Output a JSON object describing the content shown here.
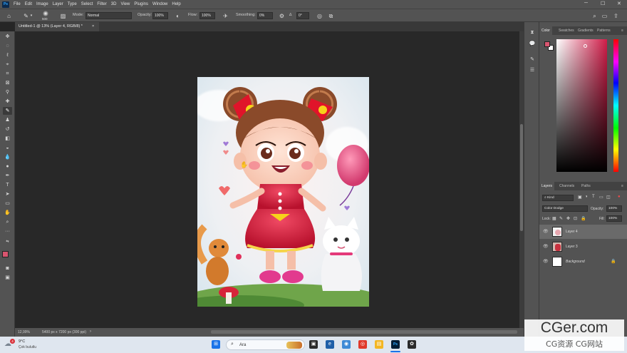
{
  "menubar": {
    "logo": "Ps",
    "items": [
      "File",
      "Edit",
      "Image",
      "Layer",
      "Type",
      "Select",
      "Filter",
      "3D",
      "View",
      "Plugins",
      "Window",
      "Help"
    ]
  },
  "options": {
    "brush_size": "500",
    "mode_label": "Mode:",
    "mode_value": "Normal",
    "opacity_label": "Opacity:",
    "opacity_value": "100%",
    "flow_label": "Flow:",
    "flow_value": "100%",
    "smoothing_label": "Smoothing:",
    "smoothing_value": "0%",
    "angle_label": "∆",
    "angle_value": "0°"
  },
  "document": {
    "tab_title": "Untitled-1 @ 13% (Layer 4, RGB/8) *",
    "tab_close": "×"
  },
  "status": {
    "zoom": "12,99%",
    "size": "5400 px x 7200 px (300 ppi)"
  },
  "color_panel": {
    "tabs": [
      "Color",
      "Swatches",
      "Gradients",
      "Patterns"
    ],
    "foreground": "#d9556f",
    "background": "#ffffff"
  },
  "layers_panel": {
    "tabs": [
      "Layers",
      "Channels",
      "Paths"
    ],
    "kind_label": "Kind",
    "blend_mode": "Color Dodge",
    "opacity_label": "Opacity:",
    "opacity_value": "100%",
    "lock_label": "Lock:",
    "fill_label": "Fill:",
    "fill_value": "100%",
    "layers": [
      {
        "name": "Layer 4",
        "selected": true
      },
      {
        "name": "Layer 3",
        "selected": false
      },
      {
        "name": "Background",
        "selected": false
      }
    ]
  },
  "taskbar": {
    "weather_temp": "9°C",
    "weather_text": "Çok bulutlu",
    "weather_badge": "4",
    "search_placeholder": "Ara"
  },
  "watermark": {
    "line1": "CGer.com",
    "line2": "CG资源 CG网站"
  }
}
